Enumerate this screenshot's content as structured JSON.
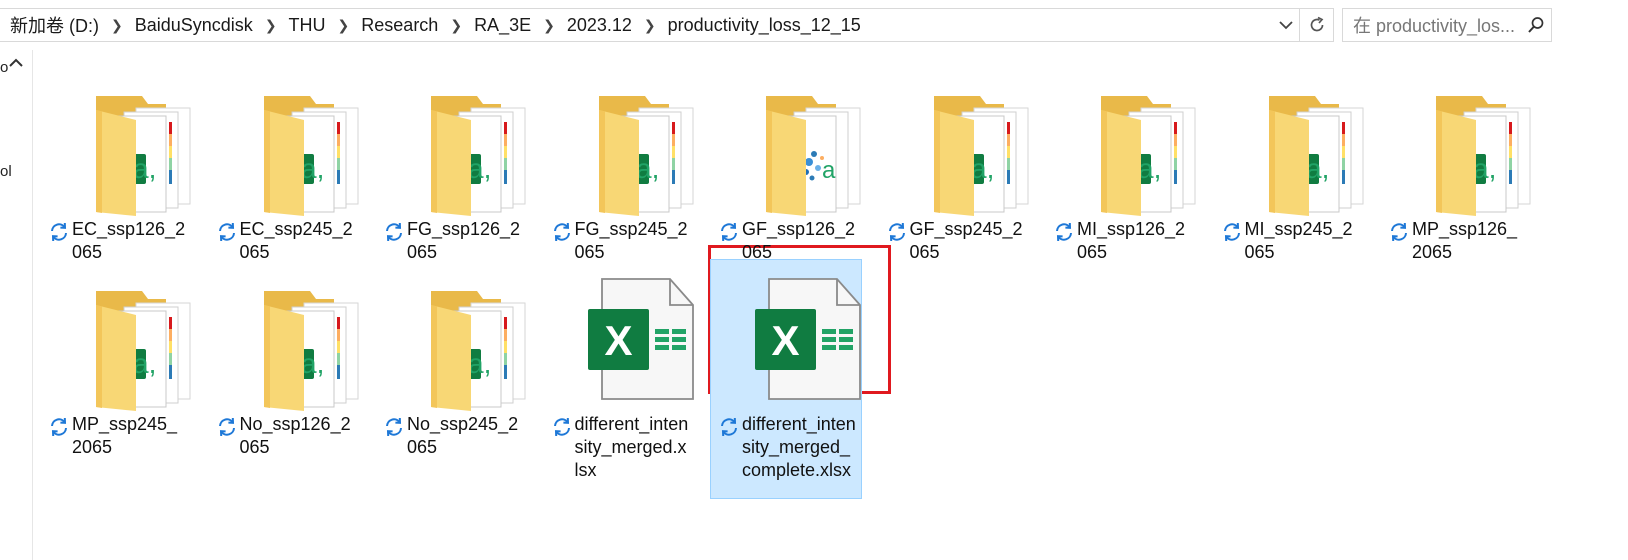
{
  "address_bar": {
    "crumbs": [
      "新加卷 (D:)",
      "BaiduSyncdisk",
      "THU",
      "Research",
      "RA_3E",
      "2023.12",
      "productivity_loss_12_15"
    ],
    "search_placeholder": "在 productivity_los..."
  },
  "nav_pane": {
    "fragment_top": "o",
    "fragment_mid": "ol"
  },
  "items": [
    {
      "name": "EC_ssp126_2065",
      "type": "folder"
    },
    {
      "name": "EC_ssp245_2065",
      "type": "folder"
    },
    {
      "name": "FG_ssp126_2065",
      "type": "folder"
    },
    {
      "name": "FG_ssp245_2065",
      "type": "folder"
    },
    {
      "name": "GF_ssp126_2065",
      "type": "folder-map"
    },
    {
      "name": "GF_ssp245_2065",
      "type": "folder"
    },
    {
      "name": "MI_ssp126_2065",
      "type": "folder"
    },
    {
      "name": "MI_ssp245_2065",
      "type": "folder"
    },
    {
      "name": "MP_ssp126_2065",
      "type": "folder"
    },
    {
      "name": "MP_ssp245_2065",
      "type": "folder"
    },
    {
      "name": "No_ssp126_2065",
      "type": "folder"
    },
    {
      "name": "No_ssp245_2065",
      "type": "folder"
    },
    {
      "name": "different_intensity_merged.xlsx",
      "type": "excel"
    },
    {
      "name": "different_intensity_merged_complete.xlsx",
      "type": "excel",
      "selected": true
    }
  ],
  "colors": {
    "folder": "#f8d775",
    "folder_back": "#e9b949",
    "excel_green": "#107c41",
    "selection": "#cce8ff",
    "highlight": "#e0191f",
    "sync": "#1e78d7"
  }
}
